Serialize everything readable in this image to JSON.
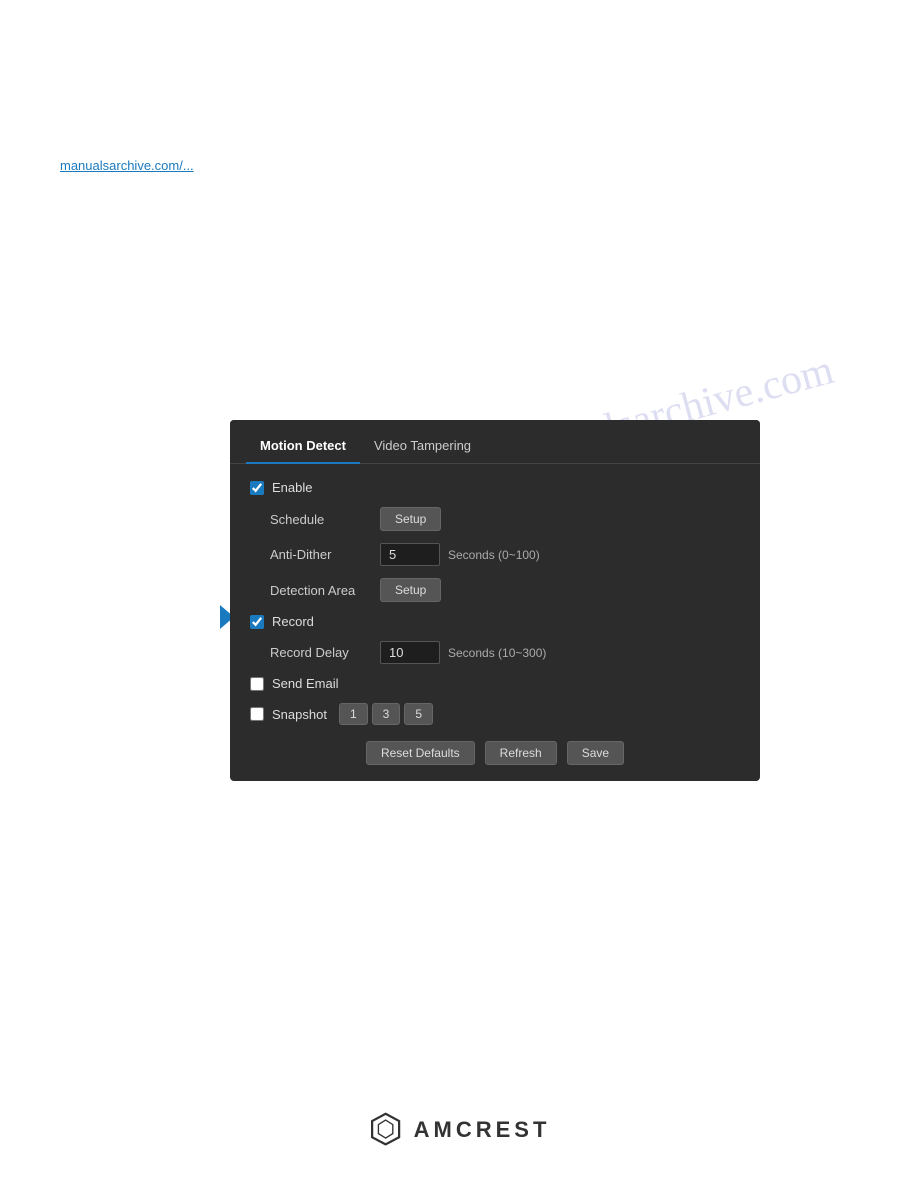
{
  "page": {
    "watermark": "manualsarchive.com",
    "top_link": "manualsarchive.com/...",
    "footer_brand": "AMCREST"
  },
  "dialog": {
    "tabs": [
      {
        "id": "motion-detect",
        "label": "Motion Detect",
        "active": true
      },
      {
        "id": "video-tampering",
        "label": "Video Tampering",
        "active": false
      }
    ],
    "enable_label": "Enable",
    "enable_checked": true,
    "schedule_label": "Schedule",
    "schedule_button": "Setup",
    "anti_dither_label": "Anti-Dither",
    "anti_dither_value": "5",
    "anti_dither_hint": "Seconds (0~100)",
    "detection_area_label": "Detection Area",
    "detection_area_button": "Setup",
    "record_label": "Record",
    "record_checked": true,
    "record_delay_label": "Record Delay",
    "record_delay_value": "10",
    "record_delay_hint": "Seconds (10~300)",
    "send_email_label": "Send Email",
    "send_email_checked": false,
    "snapshot_label": "Snapshot",
    "snapshot_checked": false,
    "snapshot_options": [
      "1",
      "3",
      "5"
    ],
    "reset_defaults_btn": "Reset Defaults",
    "refresh_btn": "Refresh",
    "save_btn": "Save"
  }
}
